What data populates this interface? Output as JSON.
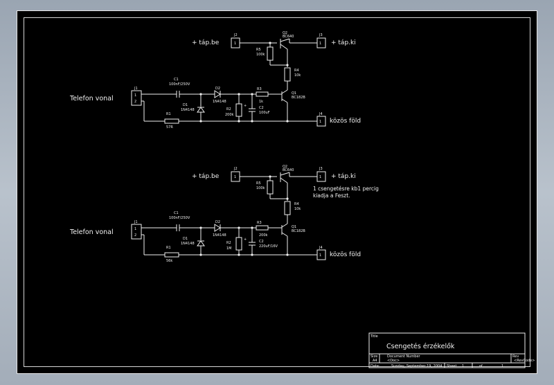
{
  "circuit1": {
    "supply_in": "+ táp.be",
    "supply_out": "+ táp.ki",
    "line_label": "Telefon vonal",
    "ground_label": "közös föld",
    "j1": "J1",
    "j2": "J2",
    "j3": "J3",
    "j4": "J4",
    "pin1": "1",
    "pin2": "2",
    "c1": "C1",
    "c1_val": "100nF/250V",
    "d1": "D1",
    "d1_val": "1N4148",
    "d2": "D2",
    "d2_val": "1N4148",
    "r1": "R1",
    "r1_val": "57R",
    "r2": "R2",
    "r2_val": "200k",
    "r3": "R3",
    "r3_val": "1k",
    "r4": "R4",
    "r4_val": "10k",
    "r5": "R5",
    "r5_val": "100k",
    "c2": "C2",
    "c2_val": "100uF",
    "q1": "Q1",
    "q1_val": "BC182B",
    "q2": "Q2",
    "q2_val": "BC640",
    "plus": "+"
  },
  "circuit2": {
    "supply_in": "+ táp.be",
    "supply_out": "+ táp.ki",
    "line_label": "Telefon vonal",
    "ground_label": "közös föld",
    "note_line1": "1 csengetésre kb1 percig",
    "note_line2": "kiadja a Feszt.",
    "j1": "J1",
    "j2": "J2",
    "j3": "J3",
    "j4": "J4",
    "pin1": "1",
    "pin2": "2",
    "c1": "C1",
    "c1_val": "100nF/250V",
    "d1": "D1",
    "d1_val": "1N4148",
    "d2": "D2",
    "d2_val": "1N4148",
    "r1": "R1",
    "r1_val": "56k",
    "r2": "R2",
    "r2_val": "1M",
    "r3": "R3",
    "r3_val": "200k",
    "r4": "R4",
    "r4_val": "10k",
    "r5": "R5",
    "r5_val": "100k",
    "c2": "C2",
    "c2_val": "220uF/16V",
    "q1": "Q1",
    "q1_val": "BC182B",
    "q2": "Q2",
    "q2_val": "BC640",
    "plus": "+"
  },
  "title_block": {
    "title_caption": "Title",
    "title": "Csengetés érzékelők",
    "size_caption": "Size",
    "size": "A4",
    "docnum_caption": "Document Number",
    "docnum": "<Doc>",
    "rev_caption": "Rev",
    "rev": "<RevCode>",
    "date_caption": "Date:",
    "date": "Sunday, September 19, 2004",
    "sheet_caption": "Sheet",
    "sheet_no": "1",
    "of_caption": "of",
    "sheet_total": "1"
  },
  "colors": {
    "background": "#000000",
    "ink": "#f0f0f0",
    "desktop": "#a3adb9"
  }
}
